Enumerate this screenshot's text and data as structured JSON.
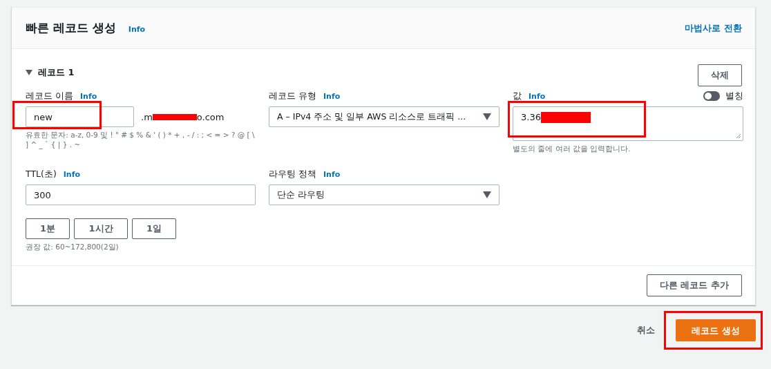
{
  "panel": {
    "title": "빠른 레코드 생성",
    "info": "Info",
    "wizard_link": "마법사로 전환"
  },
  "record": {
    "heading": "레코드 1",
    "expanded": true,
    "delete_button": "삭제",
    "name_field": {
      "label": "레코드 이름",
      "info": "Info",
      "value": "new",
      "highlighted": true,
      "domain_start": ".m",
      "domain_end": "o.com",
      "redacted": true,
      "hint": "유효한 문자: a-z, 0-9 및 ! \" # $ % & ' ( ) * + , - / : ; < = > ? @ [ \\ ] ^ _ ` { | } . ~"
    },
    "type_field": {
      "label": "레코드 유형",
      "info": "Info",
      "value": "A – IPv4 주소 및 일부 AWS 리소스로 트래픽 ..."
    },
    "value_field": {
      "label": "값",
      "info": "Info",
      "value": "3.36",
      "redacted": true,
      "highlighted": true,
      "hint": "별도의 줄에 여러 값을 입력합니다.",
      "alias_label": "별칭",
      "alias_on": false
    },
    "ttl_field": {
      "label": "TTL(초)",
      "info": "Info",
      "value": "300",
      "presets": [
        "1분",
        "1시간",
        "1일"
      ],
      "hint": "권장 값: 60~172,800(2일)"
    },
    "routing_field": {
      "label": "라우팅 정책",
      "info": "Info",
      "value": "단순 라우팅"
    }
  },
  "add_button": "다른 레코드 추가",
  "footer": {
    "cancel": "취소",
    "create": "레코드 생성",
    "create_highlighted": true
  }
}
